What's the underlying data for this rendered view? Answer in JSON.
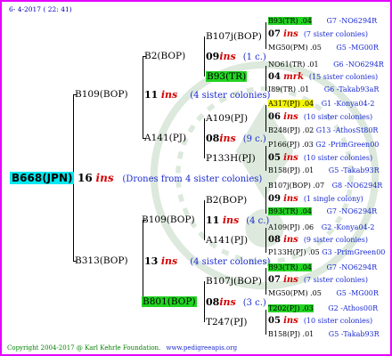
{
  "date": "6- 4-2017 ( 22: 41)",
  "copyright": "Copyright 2004-2017 @ Karl Kehrle Foundation.",
  "website": "www.pedigreeapis.org",
  "root": {
    "name": "B668(JPN)",
    "num": "16",
    "ins": "ins",
    "drones": "(Drones from 4 sister colonies)"
  },
  "gen1": [
    {
      "name": "B109(BOP)",
      "num": "11",
      "ins": "ins",
      "note": "(4 sister colonies)"
    },
    {
      "name": "B313(BOP)",
      "num": "13",
      "ins": "ins",
      "note": "(4 sister colonies)"
    }
  ],
  "gen2": [
    {
      "name": "B2(BOP)"
    },
    {
      "name": "A141(PJ)",
      "num": "08",
      "ins": "ins",
      "note": "(9 c.)"
    },
    {
      "name": "B109(BOP)",
      "num": "11",
      "ins": "ins",
      "note": "(4 c.)"
    },
    {
      "name": "B801(BOP)",
      "num": "08",
      "ins": "ins",
      "note": "(3 c.)"
    }
  ],
  "gen3": [
    {
      "name": "B107j(BOP)",
      "num": "09",
      "ins": "ins",
      "note": "(1 c.)"
    },
    {
      "name": "B93(TR)",
      "num": "04",
      "ins": "mrk",
      "note": "(15 sister colonies)"
    },
    {
      "name": "A109(PJ)",
      "num": "06",
      "ins": "ins",
      "note": "(10 sister colonies)"
    },
    {
      "name": "P133H(PJ)",
      "num": "05",
      "ins": "ins",
      "note": "(10 sister colonies)"
    },
    {
      "name": "B2(BOP)",
      "num": "09",
      "ins": "ins",
      "note": "(1 single colony)"
    },
    {
      "name": "A141(PJ)",
      "num": "08",
      "ins": "ins",
      "note": "(9 sister colonies)"
    },
    {
      "name": "B107j(BOP)",
      "num": "07",
      "ins": "ins",
      "note": "(7 sister colonies)"
    },
    {
      "name": "T247(PJ)",
      "num": "05",
      "ins": "ins",
      "note": "(10 sister colonies)"
    }
  ],
  "gen4": [
    {
      "name": "B93(TR) .04",
      "ref": "G7 -NO6294R"
    },
    {
      "name": "MG50(PM) .05",
      "ref": "G5 -MG00R"
    },
    {
      "name": "NO61(TR) .01",
      "ref": "G6 -NO6294R"
    },
    {
      "name": "I89(TR) .01",
      "ref": "G6 -Takab93aR"
    },
    {
      "name": "A317(PJ) .04",
      "ref": "G1 -Konya04-2"
    },
    {
      "name": "B248(PJ) .02",
      "ref": "G13 -AthosSt80R"
    },
    {
      "name": "P166(PJ) .03",
      "ref": "G2 -PrimGreen00"
    },
    {
      "name": "B158(PJ) .01",
      "ref": "G5 -Takab93R"
    },
    {
      "name": "B107j(BOP) .07",
      "ref": "G8 -NO6294R"
    },
    {
      "name": "B93(TR) .04",
      "ref": "G7 -NO6294R"
    },
    {
      "name": "A109(PJ) .06",
      "ref": "G2 -Konya04-2"
    },
    {
      "name": "P133H(PJ) .05",
      "ref": "G3 -PrimGreen00"
    },
    {
      "name": "B93(TR) .04",
      "ref": "G7 -NO6294R"
    },
    {
      "name": "MG50(PM) .05",
      "ref": "G5 -MG00R"
    },
    {
      "name": "T202(PJ) .03",
      "ref": "G2 -Athos00R"
    },
    {
      "name": "B158(PJ) .01",
      "ref": "G5 -Takab93R"
    }
  ]
}
